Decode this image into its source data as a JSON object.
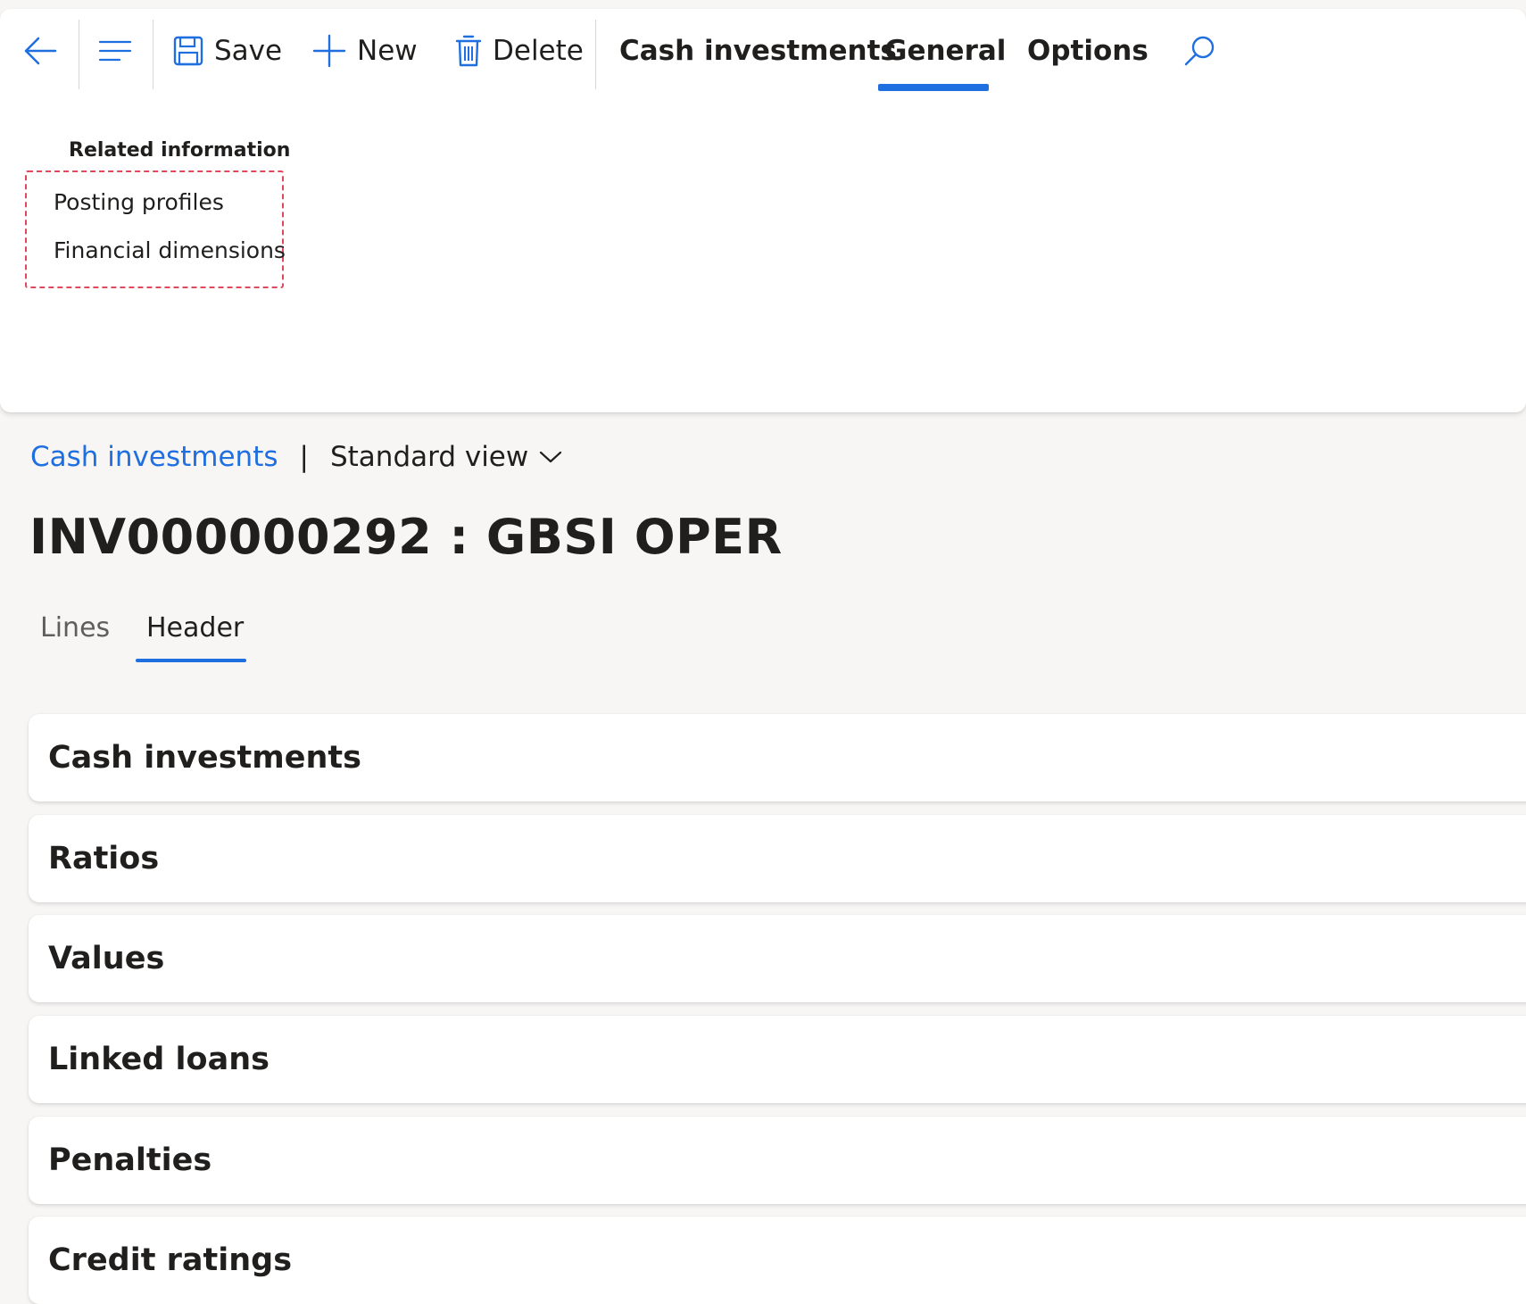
{
  "toolbar": {
    "save_label": "Save",
    "new_label": "New",
    "delete_label": "Delete",
    "tabs": [
      "Cash investments",
      "General",
      "Options"
    ],
    "active_tab": "General"
  },
  "related": {
    "title": "Related information",
    "items": [
      "Posting profiles",
      "Financial dimensions"
    ]
  },
  "breadcrumb": {
    "link": "Cash investments",
    "separator": "|",
    "view": "Standard view"
  },
  "page": {
    "title": "INV000000292 : GBSI OPER",
    "tabs": [
      "Lines",
      "Header"
    ],
    "active_tab": "Header"
  },
  "sections": [
    "Cash investments",
    "Ratios",
    "Values",
    "Linked loans",
    "Penalties",
    "Credit ratings"
  ],
  "colors": {
    "accent": "#1f6fe0",
    "highlight_border": "#e2485c",
    "background": "#f7f6f5"
  }
}
